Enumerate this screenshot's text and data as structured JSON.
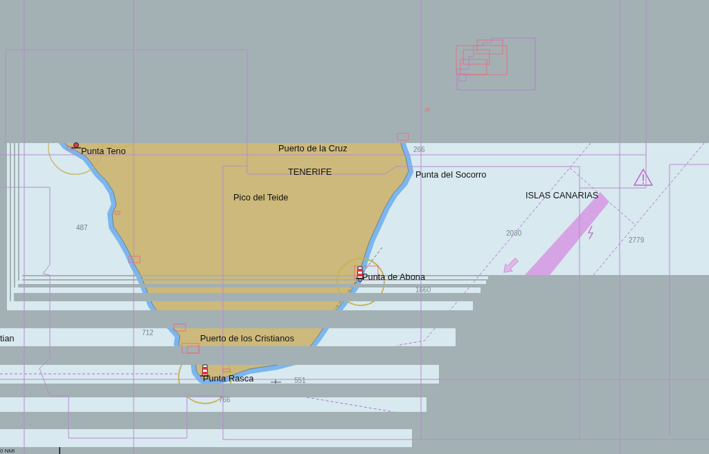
{
  "chart": {
    "labels": [
      {
        "text": "Punta Teno",
        "kind": "place"
      },
      {
        "text": "Puerto de la Cruz",
        "kind": "place"
      },
      {
        "text": "266",
        "kind": "depth"
      },
      {
        "text": "TENERIFE",
        "kind": "place"
      },
      {
        "text": "Punta del Socorro",
        "kind": "place"
      },
      {
        "text": "ISLAS CANARIAS",
        "kind": "place"
      },
      {
        "text": "Pico del Teide",
        "kind": "place"
      },
      {
        "text": "487",
        "kind": "depth"
      },
      {
        "text": "2030",
        "kind": "depth"
      },
      {
        "text": "2779",
        "kind": "depth"
      },
      {
        "text": "Punta de Abona",
        "kind": "place"
      },
      {
        "text": "1660",
        "kind": "depth"
      },
      {
        "text": "tian",
        "kind": "place"
      },
      {
        "text": "712",
        "kind": "depth"
      },
      {
        "text": "Puerto de los Cristianos",
        "kind": "place"
      },
      {
        "text": "Punta Rasca",
        "kind": "place"
      },
      {
        "text": "551",
        "kind": "depth"
      },
      {
        "text": "766",
        "kind": "depth"
      }
    ]
  },
  "scale_bar": {
    "label": "0 NMI"
  }
}
